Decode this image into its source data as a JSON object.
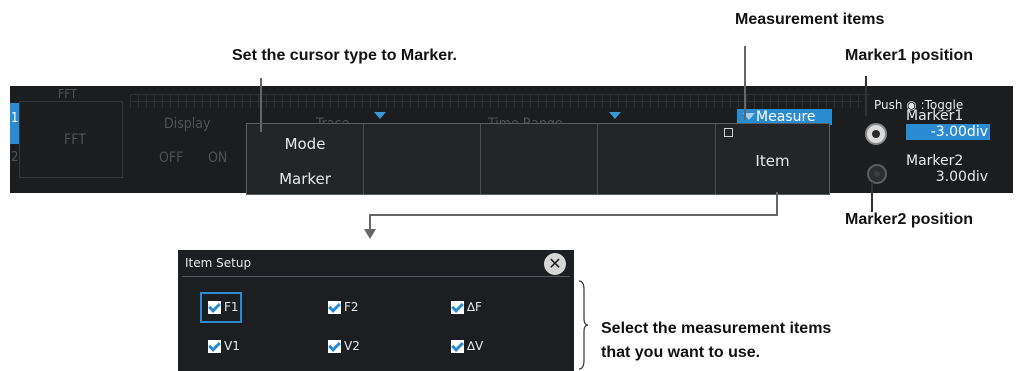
{
  "annotations": {
    "measurement_items": "Measurement items",
    "set_cursor": "Set the cursor type to Marker.",
    "marker1_position": "Marker1 position",
    "marker2_position": "Marker2 position",
    "select_line1": "Select the measurement items",
    "select_line2": "that you want to use."
  },
  "scope": {
    "tab_top": "FFT",
    "tab_main": "FFT",
    "tab_index1": "1",
    "tab_index2": "2",
    "display_label": "Display",
    "display_off": "OFF",
    "display_on": "ON",
    "trace_label": "Trace",
    "time_range_label": "Time Range",
    "measure_label": "Measure"
  },
  "menu": {
    "mode_label": "Mode",
    "mode_value": "Marker",
    "item_label": "Item"
  },
  "side_panel": {
    "push_toggle": "Push ◉ :Toggle",
    "marker1_label": "Marker1",
    "marker1_value": "-3.00div",
    "marker2_label": "Marker2",
    "marker2_value": "3.00div"
  },
  "dialog": {
    "title": "Item Setup",
    "items": [
      {
        "label": "F1",
        "checked": true
      },
      {
        "label": "F2",
        "checked": true
      },
      {
        "label": "∆F",
        "checked": true
      },
      {
        "label": "V1",
        "checked": true
      },
      {
        "label": "V2",
        "checked": true
      },
      {
        "label": "∆V",
        "checked": true
      }
    ]
  },
  "colors": {
    "accent": "#2a8bd0",
    "screen_bg": "#1b1d1f"
  }
}
